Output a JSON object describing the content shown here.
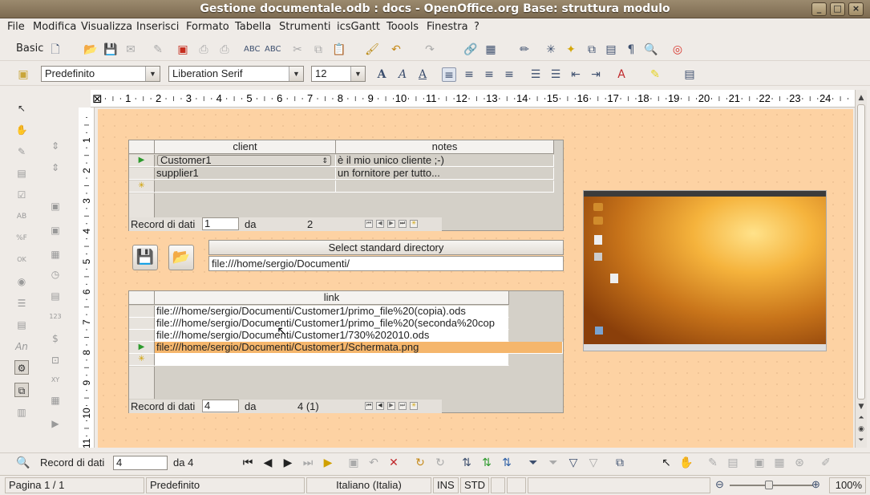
{
  "window": {
    "title": "Gestione documentale.odb : docs - OpenOffice.org Base: struttura modulo",
    "min_label": "_",
    "max_label": "□",
    "close_label": "×"
  },
  "menu": [
    "File",
    "Modifica",
    "Visualizza",
    "Inserisci",
    "Formato",
    "Tabella",
    "Strumenti",
    "icsGantt",
    "Toools",
    "Finestra",
    "?"
  ],
  "toolbar": {
    "basic_label": "Basic",
    "style_value": "Predefinito",
    "font_value": "Liberation Serif",
    "size_value": "12"
  },
  "ruler": {
    "h_ticks": [
      "1",
      "2",
      "3",
      "4",
      "5",
      "6",
      "7",
      "8",
      "9",
      "10",
      "11",
      "12",
      "13",
      "14",
      "15",
      "16",
      "17",
      "18",
      "19",
      "20",
      "21",
      "22",
      "23",
      "24"
    ],
    "v_ticks": [
      "1",
      "2",
      "3",
      "4",
      "5",
      "6",
      "7",
      "8",
      "9",
      "10",
      "11"
    ]
  },
  "client_grid": {
    "headers": [
      "client",
      "notes"
    ],
    "rows": [
      {
        "client": "Customer1",
        "notes": "è il mio unico cliente  ;-)"
      },
      {
        "client": "supplier1",
        "notes": "un fornitore per tutto..."
      }
    ],
    "nav": {
      "label": "Record di dati",
      "record": "1",
      "of": "da",
      "count": "2"
    }
  },
  "directory": {
    "button_label": "Select standard directory",
    "path": "file:///home/sergio/Documenti/"
  },
  "link_grid": {
    "header": "link",
    "rows": [
      "file:///home/sergio/Documenti/Customer1/primo_file%20(copia).ods",
      "file:///home/sergio/Documenti/Customer1/primo_file%20(seconda%20cop",
      "file:///home/sergio/Documenti/Customer1/730%202010.ods",
      "file:///home/sergio/Documenti/Customer1/Schermata.png"
    ],
    "nav": {
      "label": "Record di dati",
      "record": "4",
      "of": "da",
      "count": "4 (1)"
    }
  },
  "form_nav": {
    "label": "Record di dati",
    "record": "4",
    "of": "da 4"
  },
  "status": {
    "page": "Pagina 1 / 1",
    "style": "Predefinito",
    "language": "Italiano (Italia)",
    "ins": "INS",
    "std": "STD",
    "zoom": "100%"
  },
  "colors": {
    "canvas": "#fdd2a3",
    "selected_row": "#f5b66c"
  }
}
